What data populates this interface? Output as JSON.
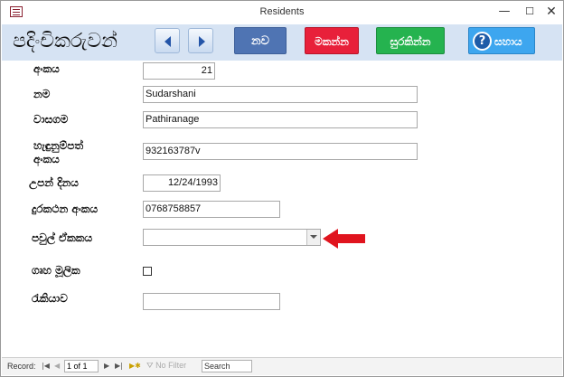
{
  "window": {
    "title": "Residents",
    "minimize_glyph": "—",
    "maximize_glyph": "☐",
    "close_glyph": "✕"
  },
  "header": {
    "form_title": "පදිංචිකරුවන්",
    "buttons": {
      "new": "නව",
      "delete": "මකන්න",
      "save": "සුරකින්න",
      "help": "සහාය"
    },
    "help_icon_glyph": "?"
  },
  "fields": {
    "id": {
      "label": "අංකය",
      "value": "21"
    },
    "name": {
      "label": "නම",
      "value": "Sudarshani"
    },
    "surname": {
      "label": "වාසගම",
      "value": "Pathiranage"
    },
    "nic": {
      "label_line1": "හැඳුනුම්පත්",
      "label_line2": "අංකය",
      "value": "932163787v"
    },
    "dob": {
      "label": "උපන් දිනය",
      "value": "12/24/1993"
    },
    "phone": {
      "label": "දුරකථන අංකය",
      "value": "0768758857"
    },
    "family_unit": {
      "label": "පවුල් ඒකකය",
      "value": ""
    },
    "household_head": {
      "label": "ගෘහ මූලික",
      "checked": false
    },
    "occupation": {
      "label": "රැකියාව",
      "value": ""
    }
  },
  "record_nav": {
    "label": "Record:",
    "position": "1 of 1",
    "filter": "No Filter",
    "search_placeholder": "Search"
  },
  "colors": {
    "header_bg": "#d6e3f3",
    "new_button": "#4f74b3",
    "delete_button": "#e8203a",
    "save_button": "#25b34f",
    "help_button": "#3da6ef",
    "annotation_arrow": "#e0141e"
  }
}
